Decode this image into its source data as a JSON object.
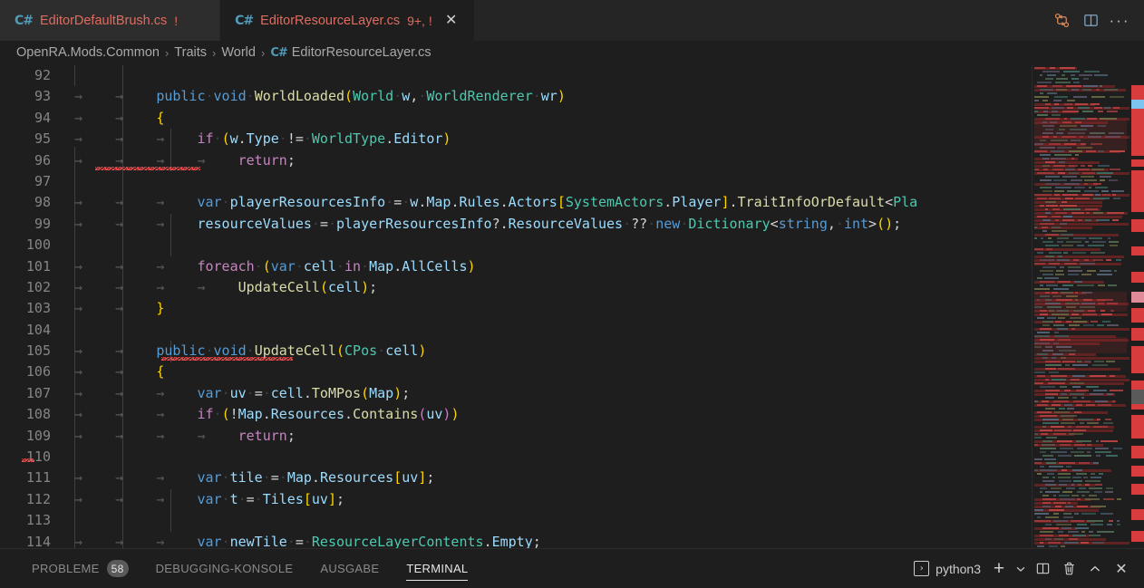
{
  "window": {
    "theme_bg": "#1e1e1e",
    "accent": "#519aba",
    "error_color": "#f14c4c"
  },
  "tabs": [
    {
      "icon": "csharp-file-icon",
      "label": "EditorDefaultBrush.cs",
      "badge": "!",
      "active": false,
      "close_glyph": "✕"
    },
    {
      "icon": "csharp-file-icon",
      "label": "EditorResourceLayer.cs",
      "badge": "9+, !",
      "active": true,
      "close_glyph": "✕"
    }
  ],
  "tabbar_actions": [
    {
      "name": "compare-changes-icon",
      "glyph": "compare"
    },
    {
      "name": "split-editor-icon",
      "glyph": "split"
    },
    {
      "name": "more-actions-icon",
      "glyph": "···"
    }
  ],
  "breadcrumb": {
    "items": [
      "OpenRA.Mods.Common",
      "Traits",
      "World"
    ],
    "file": "EditorResourceLayer.cs",
    "separator": "›"
  },
  "editor": {
    "first_line": 92,
    "tab_arrow": "→",
    "space_dot": "·",
    "lines": [
      {
        "n": 92,
        "text": ""
      },
      {
        "n": 93,
        "text": "public void WorldLoaded(World w, WorldRenderer wr)"
      },
      {
        "n": 94,
        "text": "{"
      },
      {
        "n": 95,
        "text": "if (w.Type != WorldType.Editor)"
      },
      {
        "n": 96,
        "text": "return;"
      },
      {
        "n": 97,
        "text": ""
      },
      {
        "n": 98,
        "text": "var playerResourcesInfo = w.Map.Rules.Actors[SystemActors.Player].TraitInfoOrDefault<Pla"
      },
      {
        "n": 99,
        "text": "resourceValues = playerResourcesInfo?.ResourceValues ?? new Dictionary<string, int>();"
      },
      {
        "n": 100,
        "text": ""
      },
      {
        "n": 101,
        "text": "foreach (var cell in Map.AllCells)"
      },
      {
        "n": 102,
        "text": "UpdateCell(cell);"
      },
      {
        "n": 103,
        "text": "}"
      },
      {
        "n": 104,
        "text": ""
      },
      {
        "n": 105,
        "text": "public void UpdateCell(CPos cell)"
      },
      {
        "n": 106,
        "text": "{"
      },
      {
        "n": 107,
        "text": "var uv = cell.ToMPos(Map);"
      },
      {
        "n": 108,
        "text": "if (!Map.Resources.Contains(uv))"
      },
      {
        "n": 109,
        "text": "return;"
      },
      {
        "n": 110,
        "text": ""
      },
      {
        "n": 111,
        "text": "var tile = Map.Resources[uv];"
      },
      {
        "n": 112,
        "text": "var t = Tiles[uv];"
      },
      {
        "n": 113,
        "text": ""
      },
      {
        "n": 114,
        "text": "var newTile = ResourceLayerContents.Empty;"
      }
    ]
  },
  "panel": {
    "tabs": [
      {
        "label": "PROBLEME",
        "badge": "58",
        "active": false
      },
      {
        "label": "DEBUGGING-KONSOLE",
        "badge": "",
        "active": false
      },
      {
        "label": "AUSGABE",
        "badge": "",
        "active": false
      },
      {
        "label": "TERMINAL",
        "badge": "",
        "active": true
      }
    ],
    "terminal_name": "python3",
    "terminal_icon_glyph": "›",
    "actions": [
      {
        "name": "new-terminal-icon",
        "glyph": "+"
      },
      {
        "name": "terminal-dropdown-icon",
        "glyph": "⌄"
      },
      {
        "name": "split-terminal-icon",
        "glyph": "split"
      },
      {
        "name": "kill-terminal-icon",
        "glyph": "trash"
      },
      {
        "name": "maximize-panel-icon",
        "glyph": "⌃"
      },
      {
        "name": "close-panel-icon",
        "glyph": "✕"
      }
    ]
  }
}
